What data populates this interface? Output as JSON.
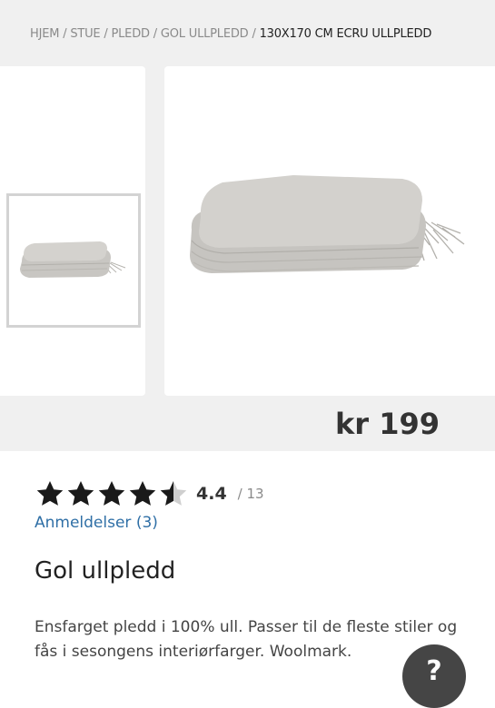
{
  "breadcrumb": {
    "items": [
      "HJEM",
      "STUE",
      "PLEDD",
      "GOL ULLPLEDD"
    ],
    "separator": "/",
    "current": "130X170 CM ECRU ULLPLEDD"
  },
  "gallery": {
    "thumbnail_icon": "folded-blanket-image",
    "main_icon": "folded-blanket-image"
  },
  "price": "kr 199",
  "rating": {
    "value": 4.4,
    "score_label": "4.4",
    "count_label": "/ 13",
    "max_stars": 5
  },
  "reviews_link": "Anmeldelser (3)",
  "product": {
    "title": "Gol ullpledd",
    "description": "Ensfarget pledd i 100% ull. Passer til de fleste stiler og fås i sesongens interiørfarger. Woolmark."
  },
  "help_button": "?",
  "colors": {
    "background_top": "#f0f0f0",
    "link": "#2f6fa6",
    "star": "#1a1a1a",
    "star_empty": "#cfcfcf",
    "help_button": "#454545"
  }
}
